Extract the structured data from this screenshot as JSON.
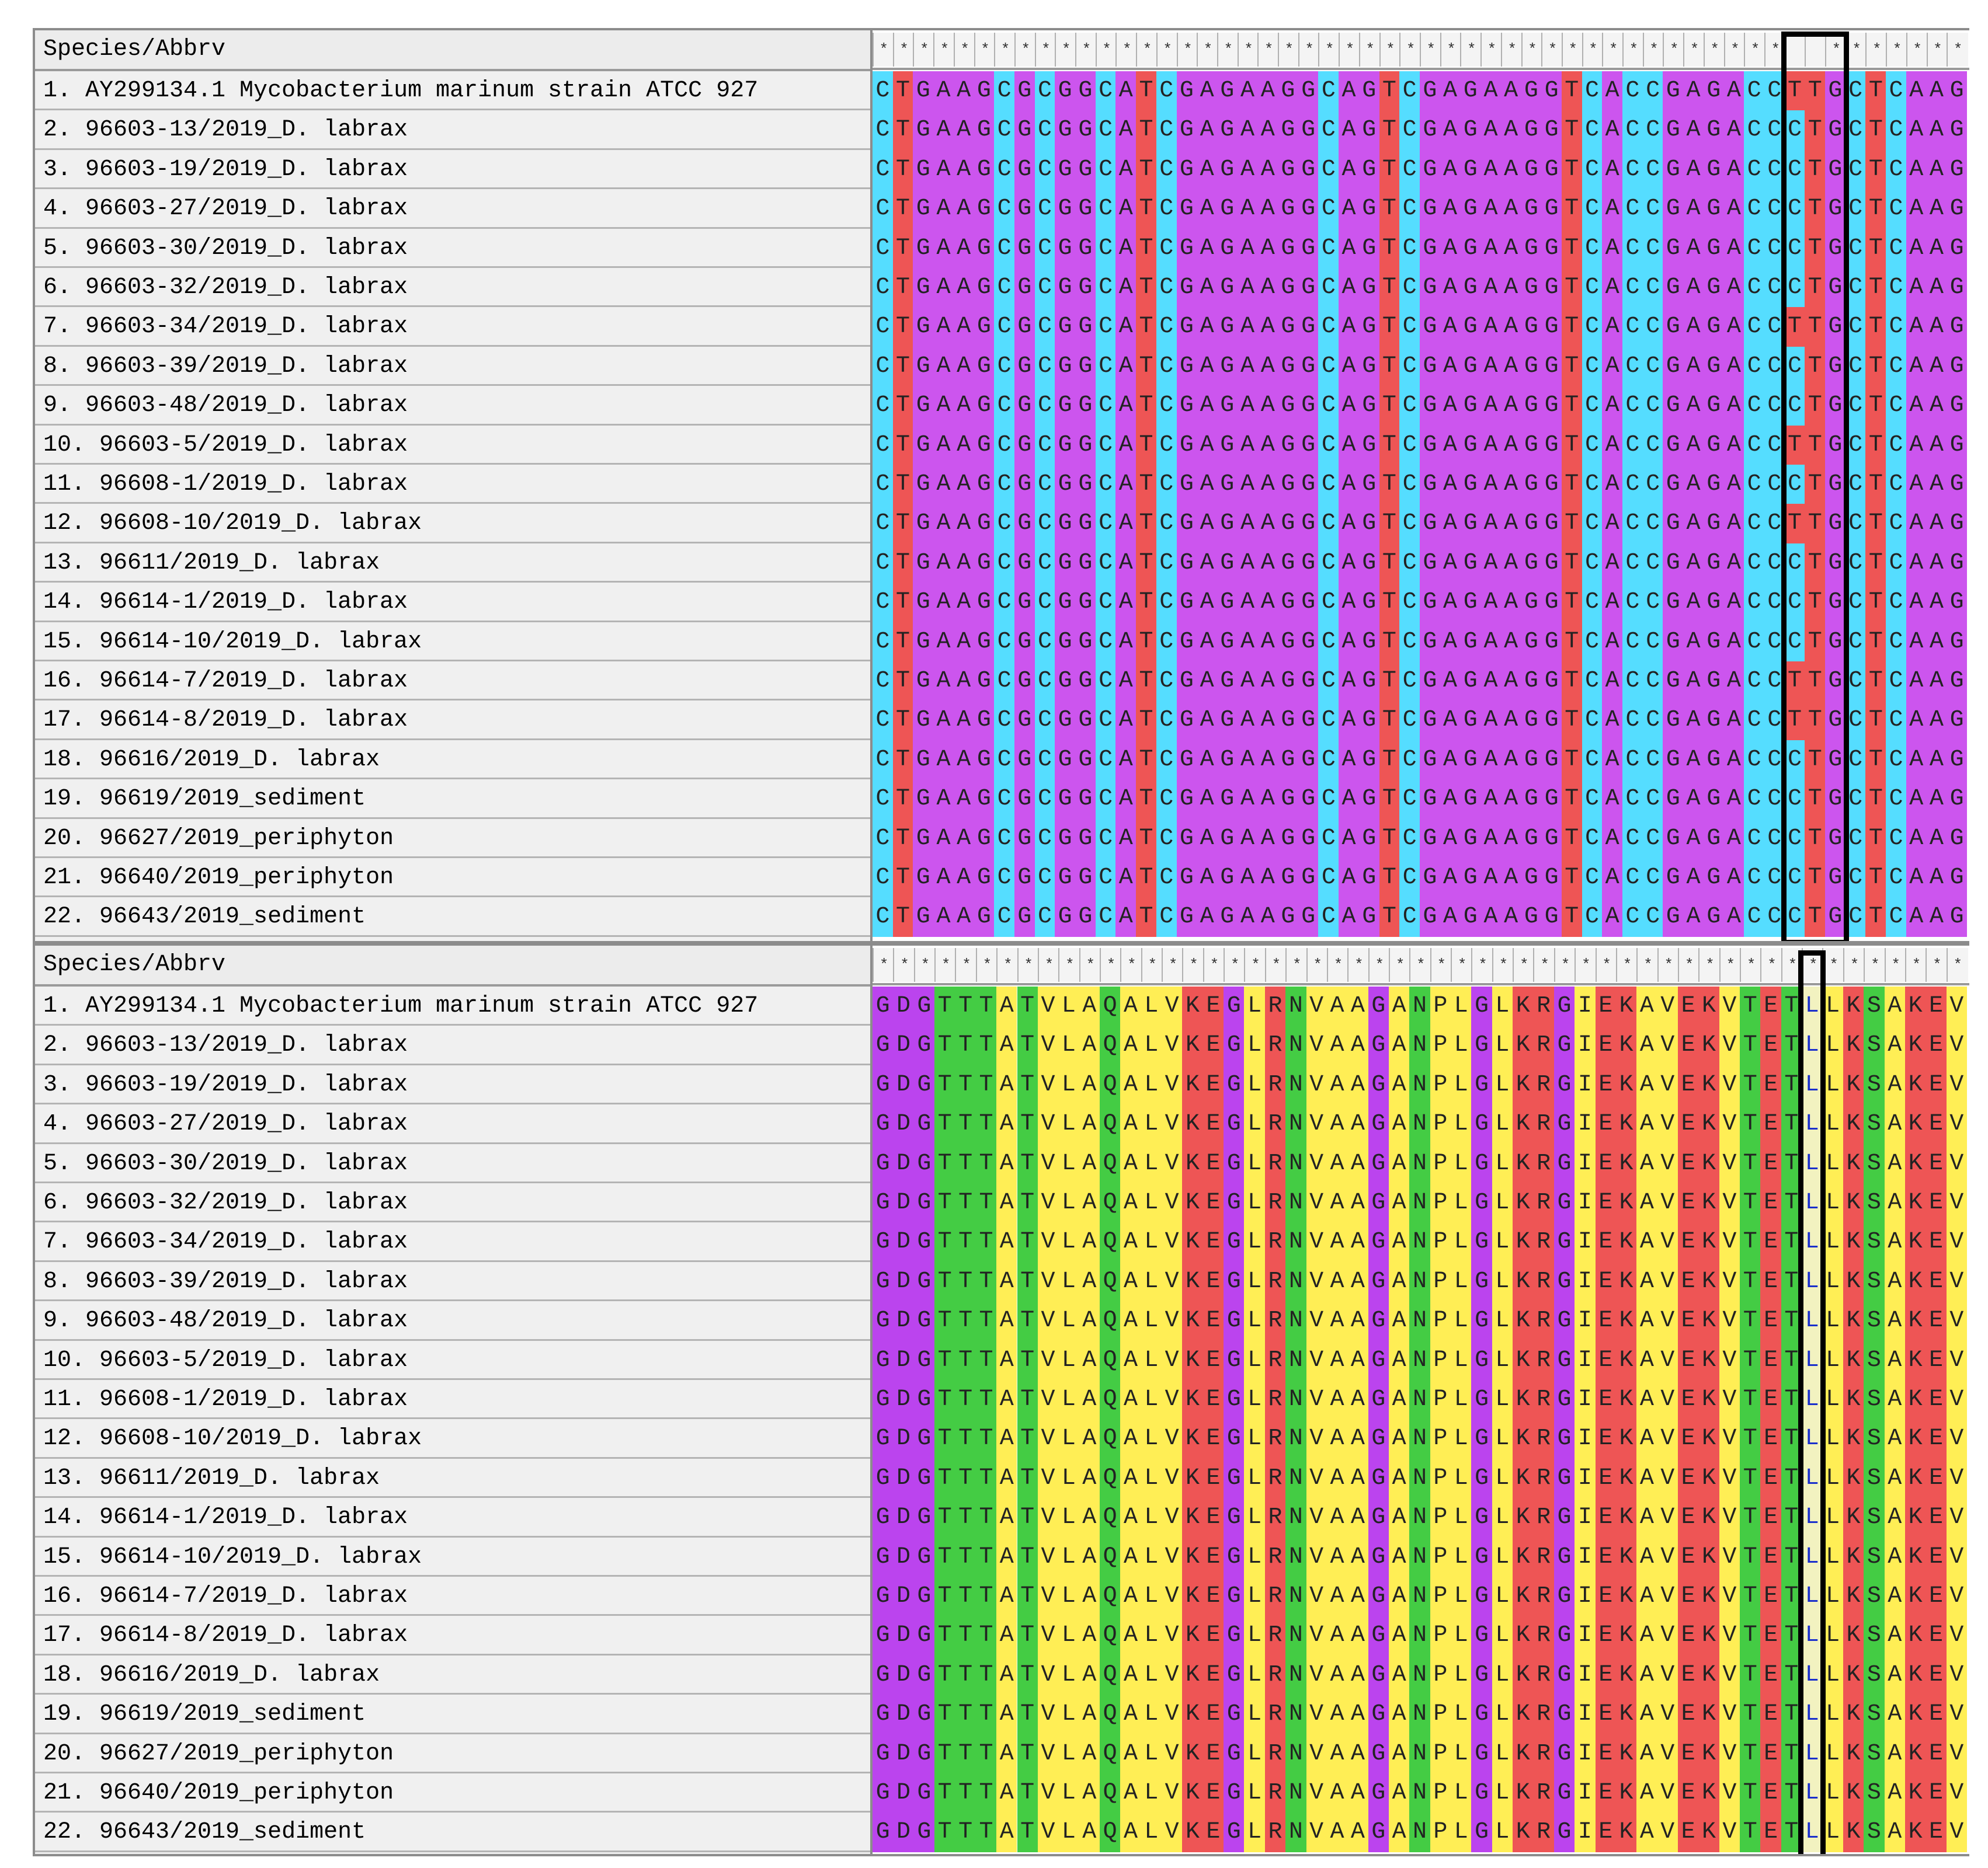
{
  "header_label": "Species/Abbrv",
  "conservation_mark": "*",
  "species": [
    "1. AY299134.1 Mycobacterium marinum strain ATCC 927",
    "2. 96603-13/2019_D. labrax",
    "3. 96603-19/2019_D. labrax",
    "4. 96603-27/2019_D. labrax",
    "5. 96603-30/2019_D. labrax",
    "6. 96603-32/2019_D. labrax",
    "7. 96603-34/2019_D. labrax",
    "8. 96603-39/2019_D. labrax",
    "9. 96603-48/2019_D. labrax",
    "10. 96603-5/2019_D. labrax",
    "11. 96608-1/2019_D. labrax",
    "12. 96608-10/2019_D. labrax",
    "13. 96611/2019_D. labrax",
    "14. 96614-1/2019_D. labrax",
    "15. 96614-10/2019_D. labrax",
    "16. 96614-7/2019_D. labrax",
    "17. 96614-8/2019_D. labrax",
    "18. 96616/2019_D. labrax",
    "19. 96619/2019_sediment",
    "20. 96627/2019_periphyton",
    "21. 96640/2019_periphyton",
    "22. 96643/2019_sediment"
  ],
  "dna_alignment": {
    "sequences": [
      "CTGAAGCGCGGCATCGAGAAGGCAGTCGAGAAGGTCACCGAGACCTTGCTCAAG",
      "CTGAAGCGCGGCATCGAGAAGGCAGTCGAGAAGGTCACCGAGACCCTGCTCAAG",
      "CTGAAGCGCGGCATCGAGAAGGCAGTCGAGAAGGTCACCGAGACCCTGCTCAAG",
      "CTGAAGCGCGGCATCGAGAAGGCAGTCGAGAAGGTCACCGAGACCCTGCTCAAG",
      "CTGAAGCGCGGCATCGAGAAGGCAGTCGAGAAGGTCACCGAGACCCTGCTCAAG",
      "CTGAAGCGCGGCATCGAGAAGGCAGTCGAGAAGGTCACCGAGACCCTGCTCAAG",
      "CTGAAGCGCGGCATCGAGAAGGCAGTCGAGAAGGTCACCGAGACCTTGCTCAAG",
      "CTGAAGCGCGGCATCGAGAAGGCAGTCGAGAAGGTCACCGAGACCCTGCTCAAG",
      "CTGAAGCGCGGCATCGAGAAGGCAGTCGAGAAGGTCACCGAGACCCTGCTCAAG",
      "CTGAAGCGCGGCATCGAGAAGGCAGTCGAGAAGGTCACCGAGACCTTGCTCAAG",
      "CTGAAGCGCGGCATCGAGAAGGCAGTCGAGAAGGTCACCGAGACCCTGCTCAAG",
      "CTGAAGCGCGGCATCGAGAAGGCAGTCGAGAAGGTCACCGAGACCTTGCTCAAG",
      "CTGAAGCGCGGCATCGAGAAGGCAGTCGAGAAGGTCACCGAGACCCTGCTCAAG",
      "CTGAAGCGCGGCATCGAGAAGGCAGTCGAGAAGGTCACCGAGACCCTGCTCAAG",
      "CTGAAGCGCGGCATCGAGAAGGCAGTCGAGAAGGTCACCGAGACCCTGCTCAAG",
      "CTGAAGCGCGGCATCGAGAAGGCAGTCGAGAAGGTCACCGAGACCTTGCTCAAG",
      "CTGAAGCGCGGCATCGAGAAGGCAGTCGAGAAGGTCACCGAGACCTTGCTCAAG",
      "CTGAAGCGCGGCATCGAGAAGGCAGTCGAGAAGGTCACCGAGACCCTGCTCAAG",
      "CTGAAGCGCGGCATCGAGAAGGCAGTCGAGAAGGTCACCGAGACCCTGCTCAAG",
      "CTGAAGCGCGGCATCGAGAAGGCAGTCGAGAAGGTCACCGAGACCCTGCTCAAG",
      "CTGAAGCGCGGCATCGAGAAGGCAGTCGAGAAGGTCACCGAGACCCTGCTCAAG",
      "CTGAAGCGCGGCATCGAGAAGGCAGTCGAGAAGGTCACCGAGACCCTGCTCAAG"
    ],
    "conservation": "*********************************************  ********",
    "highlight_columns": [
      45,
      47
    ],
    "colors": {
      "A": "#cc55ee",
      "C": "#55ddff",
      "G": "#cc55ee",
      "T": "#ee5555"
    }
  },
  "protein_alignment": {
    "sequences": [
      "GDGTTTATVLAQALVKEGLRNVAAGANPLGLKRGIEKAVEKVTETLLKSAKEV",
      "GDGTTTATVLAQALVKEGLRNVAAGANPLGLKRGIEKAVEKVTETLLKSAKEV",
      "GDGTTTATVLAQALVKEGLRNVAAGANPLGLKRGIEKAVEKVTETLLKSAKEV",
      "GDGTTTATVLAQALVKEGLRNVAAGANPLGLKRGIEKAVEKVTETLLKSAKEV",
      "GDGTTTATVLAQALVKEGLRNVAAGANPLGLKRGIEKAVEKVTETLLKSAKEV",
      "GDGTTTATVLAQALVKEGLRNVAAGANPLGLKRGIEKAVEKVTETLLKSAKEV",
      "GDGTTTATVLAQALVKEGLRNVAAGANPLGLKRGIEKAVEKVTETLLKSAKEV",
      "GDGTTTATVLAQALVKEGLRNVAAGANPLGLKRGIEKAVEKVTETLLKSAKEV",
      "GDGTTTATVLAQALVKEGLRNVAAGANPLGLKRGIEKAVEKVTETLLKSAKEV",
      "GDGTTTATVLAQALVKEGLRNVAAGANPLGLKRGIEKAVEKVTETLLKSAKEV",
      "GDGTTTATVLAQALVKEGLRNVAAGANPLGLKRGIEKAVEKVTETLLKSAKEV",
      "GDGTTTATVLAQALVKEGLRNVAAGANPLGLKRGIEKAVEKVTETLLKSAKEV",
      "GDGTTTATVLAQALVKEGLRNVAAGANPLGLKRGIEKAVEKVTETLLKSAKEV",
      "GDGTTTATVLAQALVKEGLRNVAAGANPLGLKRGIEKAVEKVTETLLKSAKEV",
      "GDGTTTATVLAQALVKEGLRNVAAGANPLGLKRGIEKAVEKVTETLLKSAKEV",
      "GDGTTTATVLAQALVKEGLRNVAAGANPLGLKRGIEKAVEKVTETLLKSAKEV",
      "GDGTTTATVLAQALVKEGLRNVAAGANPLGLKRGIEKAVEKVTETLLKSAKEV",
      "GDGTTTATVLAQALVKEGLRNVAAGANPLGLKRGIEKAVEKVTETLLKSAKEV",
      "GDGTTTATVLAQALVKEGLRNVAAGANPLGLKRGIEKAVEKVTETLLKSAKEV",
      "GDGTTTATVLAQALVKEGLRNVAAGANPLGLKRGIEKAVEKVTETLLKSAKEV",
      "GDGTTTATVLAQALVKEGLRNVAAGANPLGLKRGIEKAVEKVTETLLKSAKEV",
      "GDGTTTATVLAQALVKEGLRNVAAGANPLGLKRGIEKAVEKVTETLLKSAKEV"
    ],
    "conservation": "*****************************************************",
    "highlight_columns": [
      45,
      45
    ],
    "colors": {
      "G": "#bb44ee",
      "D": "#bb44ee",
      "E": "#ee5555",
      "K": "#ee5555",
      "R": "#ee5555",
      "T": "#44cc44",
      "N": "#44cc44",
      "Q": "#44cc44",
      "S": "#44cc44",
      "A": "#ffee55",
      "V": "#ffee55",
      "L": "#ffee55",
      "I": "#ffee55",
      "P": "#ffee55"
    }
  }
}
